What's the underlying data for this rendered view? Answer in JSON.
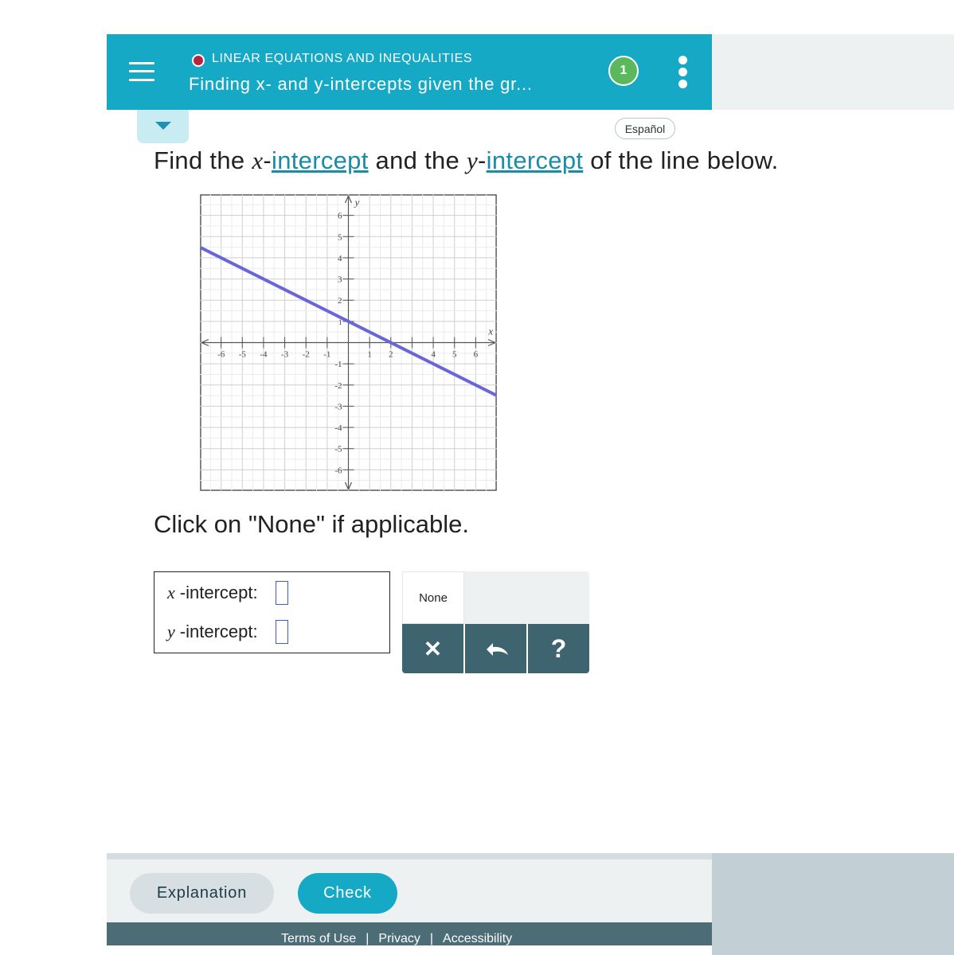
{
  "header": {
    "topic": "LINEAR EQUATIONS AND INEQUALITIES",
    "title": "Finding x- and y-intercepts given the gr...",
    "progress": "1",
    "icons": {
      "menu": "hamburger-icon",
      "topic_status": "red-dot-icon",
      "more": "kebab-menu-icon"
    }
  },
  "language_button": "Español",
  "question": {
    "part1": "Find the ",
    "x_var": "x",
    "dash1": "-",
    "link1": "intercept",
    "part2": " and the ",
    "y_var": "y",
    "dash2": "-",
    "link2": "intercept",
    "part3": " of the line below."
  },
  "chart_data": {
    "type": "line",
    "xlabel": "x",
    "ylabel": "y",
    "xlim": [
      -7,
      7
    ],
    "ylim": [
      -7,
      7
    ],
    "grid": true,
    "x_ticks": [
      -6,
      -5,
      -4,
      -3,
      -2,
      -1,
      1,
      2,
      4,
      5,
      6
    ],
    "y_ticks": [
      6,
      5,
      4,
      3,
      2,
      -1,
      -2,
      -3,
      -4,
      -5,
      -6
    ],
    "small_labels": [
      "1"
    ],
    "series": [
      {
        "x": [
          -7,
          7
        ],
        "y": [
          4.5,
          -2.5
        ],
        "color": "#6a66d9"
      }
    ]
  },
  "none_prompt": "Click on \"None\" if applicable.",
  "answers": {
    "x_var": "x",
    "x_label": "-intercept:",
    "y_var": "y",
    "y_label": "-intercept:"
  },
  "keypad": {
    "none_label": "None",
    "clear_symbol": "✕",
    "help_symbol": "?",
    "icons": {
      "clear": "clear-icon",
      "undo": "undo-icon",
      "help": "help-icon"
    }
  },
  "footer": {
    "explanation": "Explanation",
    "check": "Check",
    "terms": "Terms of Use",
    "privacy": "Privacy",
    "accessibility": "Accessibility",
    "separator": "|"
  },
  "colors": {
    "header_bg": "#16a9c6",
    "topic_dot": "#b8243d",
    "progress_badge": "#5cb85c",
    "link": "#1a8ba8",
    "line": "#6a66d9",
    "keypad_button": "#3e6470",
    "legal_bar": "#4c6c76"
  }
}
